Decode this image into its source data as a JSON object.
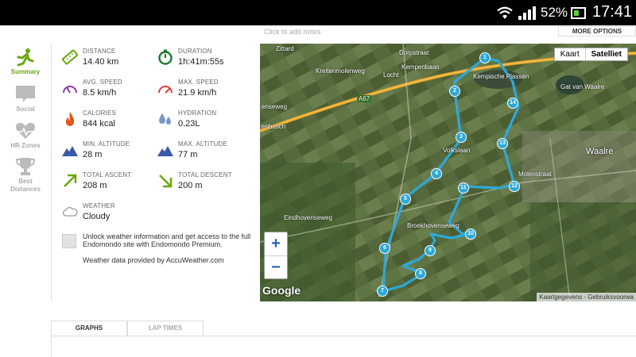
{
  "status_bar": {
    "battery_percent": "52%",
    "time": "17:41",
    "icons": [
      "wifi-icon",
      "signal-icon",
      "battery-icon"
    ]
  },
  "header": {
    "notes_placeholder": "Click to add notes",
    "more_options": "MORE OPTIONS"
  },
  "sidebar": {
    "items": [
      {
        "label": "Summary",
        "icon": "runner-icon",
        "active": true
      },
      {
        "label": "Social",
        "icon": "speech-bubble-icon",
        "active": false
      },
      {
        "label": "HR Zones",
        "icon": "heart-icon",
        "active": false
      },
      {
        "label": "Best Distances",
        "icon": "trophy-icon",
        "active": false
      }
    ]
  },
  "stats": {
    "distance": {
      "label": "DISTANCE",
      "value": "14.40 km"
    },
    "duration": {
      "label": "DURATION",
      "value": "1h:41m:55s"
    },
    "avg_speed": {
      "label": "AVG. SPEED",
      "value": "8.5 km/h"
    },
    "max_speed": {
      "label": "MAX. SPEED",
      "value": "21.9 km/h"
    },
    "calories": {
      "label": "CALORIES",
      "value": "844 kcal"
    },
    "hydration": {
      "label": "HYDRATION",
      "value": "0.23L"
    },
    "min_altitude": {
      "label": "MIN. ALTITUDE",
      "value": "28 m"
    },
    "max_altitude": {
      "label": "MAX. ALTITUDE",
      "value": "77 m"
    },
    "total_ascent": {
      "label": "TOTAL ASCENT",
      "value": "208 m"
    },
    "total_descent": {
      "label": "TOTAL DESCENT",
      "value": "200 m"
    },
    "weather": {
      "label": "WEATHER",
      "value": "Cloudy"
    }
  },
  "weather_promo": {
    "text": "Unlock weather information and get access to the full Endomondo site with Endomondo Premium.",
    "source": "Weather data provided by AccuWeather.com"
  },
  "map": {
    "toggle": {
      "map": "Kaart",
      "satellite": "Satelliet"
    },
    "zoom_in": "+",
    "zoom_out": "−",
    "logo": "Google",
    "attribution": "Kaartgegevens - Gebruiksvoorwa",
    "labels": {
      "zittard": "Zittard",
      "dorpstraat": "Dorpstraat",
      "kempenbaan": "Kempenbaan",
      "kreitenmolenweg": "Kreitenmolenweg",
      "locht": "Locht",
      "kempische_plassen": "Kempische Plassen",
      "gat_van_waalre": "Gat van Waalre",
      "a67": "A67",
      "enseweg": "enseweg",
      "enbosch": "enbosch",
      "waalre": "Waalre",
      "molenstraat": "Molenstraat",
      "eindhovenseweg": "Eindhovenseweg",
      "broekhovenseweg": "Broekhovenseweg",
      "volkslaan": "Volkslaan"
    },
    "markers": [
      "1",
      "2",
      "3",
      "4",
      "5",
      "6",
      "7",
      "8",
      "9",
      "10",
      "11",
      "12",
      "13",
      "14"
    ]
  },
  "tabs": [
    {
      "label": "GRAPHS",
      "active": true
    },
    {
      "label": "LAP TIMES",
      "active": false
    }
  ],
  "colors": {
    "accent_green": "#6aa80f",
    "route": "#2ea8d8",
    "status_bar": "#000000"
  }
}
